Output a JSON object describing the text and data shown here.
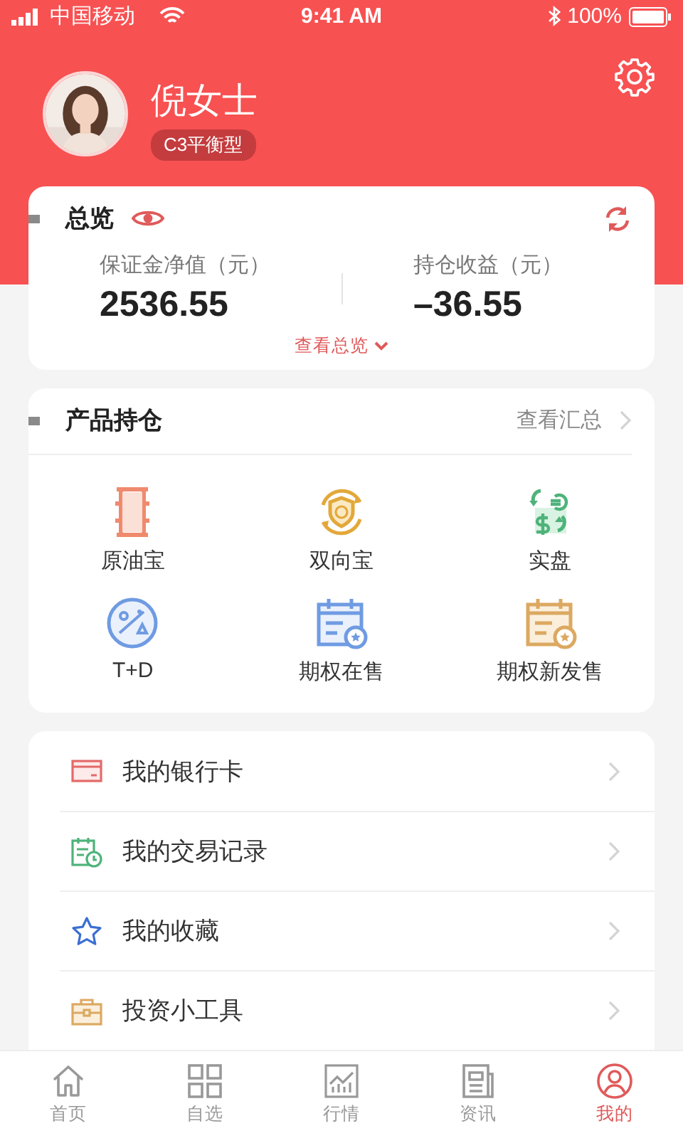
{
  "status_bar": {
    "carrier": "中国移动",
    "time": "9:41 AM",
    "battery": "100%"
  },
  "profile": {
    "name": "倪女士",
    "risk_tag": "C3平衡型"
  },
  "overview": {
    "title": "总览",
    "link": "查看总览",
    "stats": [
      {
        "label": "保证金净值（元）",
        "value": "2536.55"
      },
      {
        "label": "持仓收益（元）",
        "value": "–36.55"
      }
    ]
  },
  "holdings": {
    "title": "产品持仓",
    "link": "查看汇总",
    "products": [
      {
        "kind": "barrel",
        "label": "原油宝"
      },
      {
        "kind": "shield",
        "label": "双向宝"
      },
      {
        "kind": "exchange",
        "label": "实盘"
      },
      {
        "kind": "percent",
        "label": "T+D"
      },
      {
        "kind": "calendar_blue",
        "label": "期权在售"
      },
      {
        "kind": "calendar_gold",
        "label": "期权新发售"
      }
    ]
  },
  "menu": [
    {
      "kind": "card",
      "label": "我的银行卡"
    },
    {
      "kind": "record",
      "label": "我的交易记录"
    },
    {
      "kind": "star",
      "label": "我的收藏"
    },
    {
      "kind": "toolbox",
      "label": "投资小工具"
    }
  ],
  "tabs": [
    {
      "kind": "home",
      "label": "首页",
      "selected": false
    },
    {
      "kind": "grid",
      "label": "自选",
      "selected": false
    },
    {
      "kind": "chart",
      "label": "行情",
      "selected": false
    },
    {
      "kind": "news",
      "label": "资讯",
      "selected": false
    },
    {
      "kind": "person",
      "label": "我的",
      "selected": true
    }
  ]
}
